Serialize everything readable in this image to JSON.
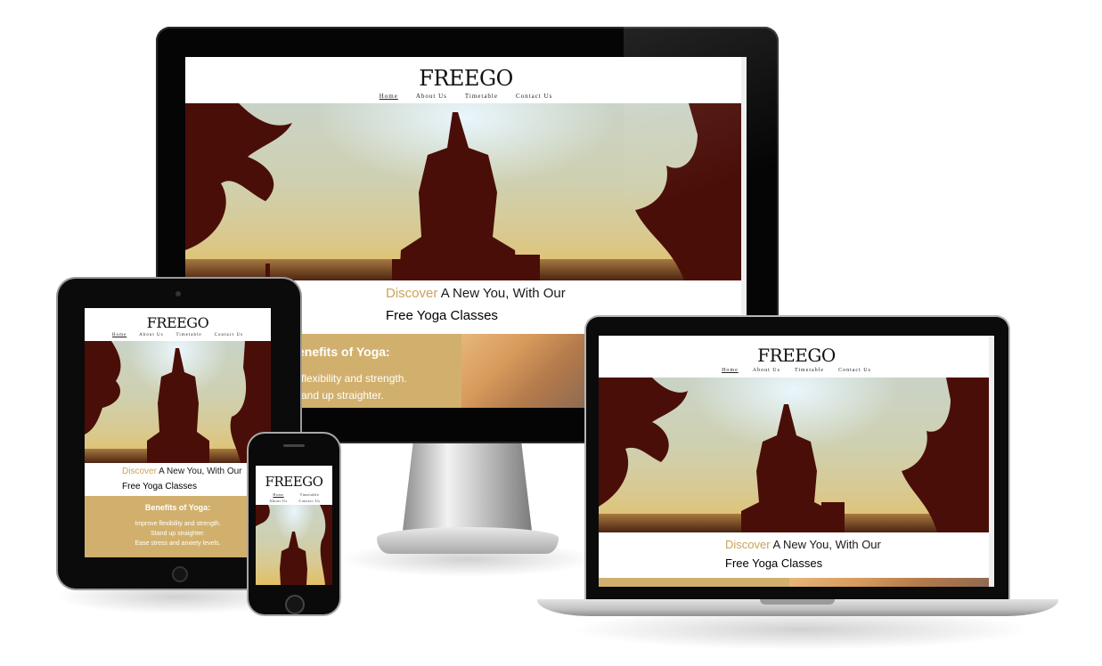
{
  "site": {
    "logo": "FREEGO",
    "nav": [
      "Home",
      "About Us",
      "Timetable",
      "Contact Us"
    ],
    "headline_accent": "Discover",
    "headline_rest": " A New You, With Our",
    "subheadline": "Free Yoga Classes",
    "benefits_title": "Benefits of Yoga:",
    "benefits": [
      "Improve flexibility and strength.",
      "Stand up straighter.",
      "Ease stress and anxiety levels."
    ]
  },
  "desktop": {
    "benefits_title_cropped": "enefits of Yoga:",
    "benefit_lines_cropped": [
      "flexibility and strength.",
      "and up straighter."
    ]
  },
  "colors": {
    "accent_gold": "#c9a35a",
    "panel_gold": "#d1b06d",
    "silhouette": "#4a0e08"
  },
  "icons": [
    "yoga-silhouette-icon",
    "tree-silhouette-icon"
  ]
}
